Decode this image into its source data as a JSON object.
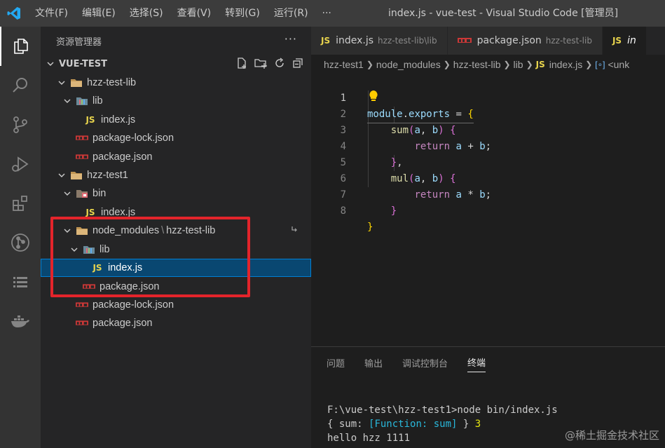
{
  "titlebar": {
    "menus": [
      "文件(F)",
      "编辑(E)",
      "选择(S)",
      "查看(V)",
      "转到(G)",
      "运行(R)",
      "···"
    ],
    "window_title": "index.js - vue-test - Visual Studio Code [管理员]"
  },
  "activitybar": {
    "icons": [
      "explorer-icon",
      "search-icon",
      "source-control-icon",
      "run-debug-icon",
      "extensions-icon",
      "git-graph-icon",
      "list-icon",
      "docker-icon"
    ]
  },
  "sidebar": {
    "title": "资源管理器",
    "more": "···",
    "section": "VUE-TEST",
    "tree": [
      {
        "label": "hzz-test-lib",
        "kind": "folder",
        "open": true
      },
      {
        "label": "lib",
        "kind": "lib-folder",
        "open": true
      },
      {
        "label": "index.js",
        "kind": "js"
      },
      {
        "label": "package-lock.json",
        "kind": "npm"
      },
      {
        "label": "package.json",
        "kind": "npm"
      },
      {
        "label": "hzz-test1",
        "kind": "folder",
        "open": true
      },
      {
        "label": "bin",
        "kind": "bin-folder",
        "open": true
      },
      {
        "label": "index.js",
        "kind": "js"
      },
      {
        "label": "node_modules",
        "label2": "hzz-test-lib",
        "sep": "\\",
        "kind": "folder",
        "open": true
      },
      {
        "label": "lib",
        "kind": "lib-folder",
        "open": true
      },
      {
        "label": "index.js",
        "kind": "js",
        "selected": true
      },
      {
        "label": "package.json",
        "kind": "npm"
      },
      {
        "label": "package-lock.json",
        "kind": "npm"
      },
      {
        "label": "package.json",
        "kind": "npm"
      }
    ]
  },
  "editor": {
    "tabs": [
      {
        "icon": "JS",
        "label": "index.js",
        "desc": "hzz-test-lib\\lib"
      },
      {
        "icon": "npm",
        "label": "package.json",
        "desc": "hzz-test-lib"
      },
      {
        "icon": "JS",
        "label": "in",
        "desc": ""
      }
    ],
    "breadcrumbs": [
      "hzz-test1",
      "node_modules",
      "hzz-test-lib",
      "lib",
      "index.js",
      "<unk"
    ],
    "line_numbers": [
      "1",
      "2",
      "3",
      "4",
      "5",
      "6",
      "7",
      "8"
    ]
  },
  "panel": {
    "tabs": [
      "问题",
      "输出",
      "调试控制台",
      "终端"
    ],
    "active_tab": "终端",
    "terminal": {
      "line1": "F:\\vue-test\\hzz-test1>node bin/index.js",
      "line2_a": "{ sum: ",
      "line2_b": "[Function: sum]",
      "line2_c": " } ",
      "line2_d": "3",
      "line3": "hello hzz 1111"
    }
  },
  "watermark": "@稀土掘金技术社区",
  "colors": {
    "accent": "#007fd4",
    "highlight_box": "#e3242b",
    "js": "#e8d44d"
  }
}
